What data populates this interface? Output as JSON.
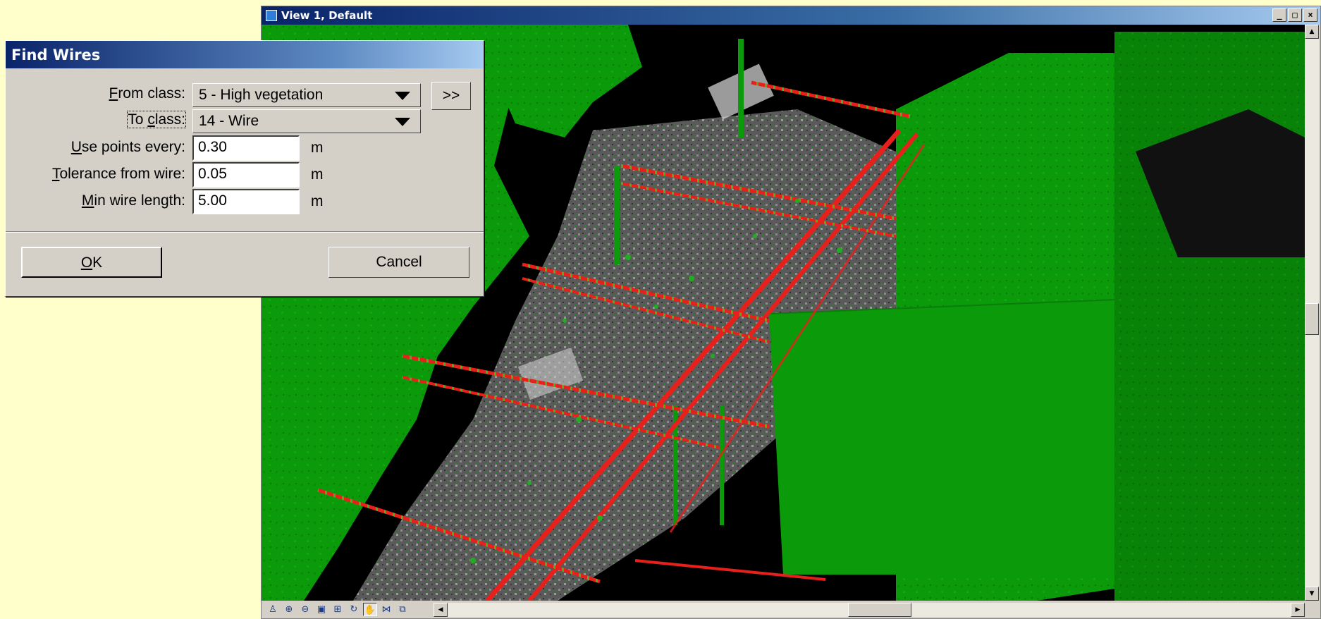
{
  "view_window": {
    "title": "View 1, Default",
    "controls": [
      "_",
      "□",
      "×"
    ]
  },
  "dialog": {
    "title": "Find Wires",
    "fields": {
      "from_class": {
        "label_prefix": "",
        "label_u": "F",
        "label_rest": "rom class:",
        "value": "5 - High vegetation"
      },
      "to_class": {
        "label_prefix": "To ",
        "label_u": "c",
        "label_rest": "lass:",
        "value": "14 - Wire"
      },
      "use_points_every": {
        "label_prefix": "",
        "label_u": "U",
        "label_rest": "se points every:",
        "value": "0.30",
        "unit": "m"
      },
      "tolerance_from_wire": {
        "label_prefix": "",
        "label_u": "T",
        "label_rest": "olerance from wire:",
        "value": "0.05",
        "unit": "m"
      },
      "min_wire_length": {
        "label_prefix": "",
        "label_u": "M",
        "label_rest": "in wire length:",
        "value": "5.00",
        "unit": "m"
      }
    },
    "more_button": ">>",
    "ok_u": "O",
    "ok_rest": "K",
    "cancel_button": "Cancel"
  },
  "colors": {
    "vegetation": "#0a9a0a",
    "wire": "#e8201c",
    "background": "#ffffcc",
    "titlebar_start": "#0a246a"
  },
  "bottom_tools": [
    "person-icon",
    "zoom-in-icon",
    "zoom-out-icon",
    "fit-view-icon",
    "fit-all-icon",
    "rotate-icon",
    "pan-icon",
    "walk-icon",
    "views-icon"
  ]
}
